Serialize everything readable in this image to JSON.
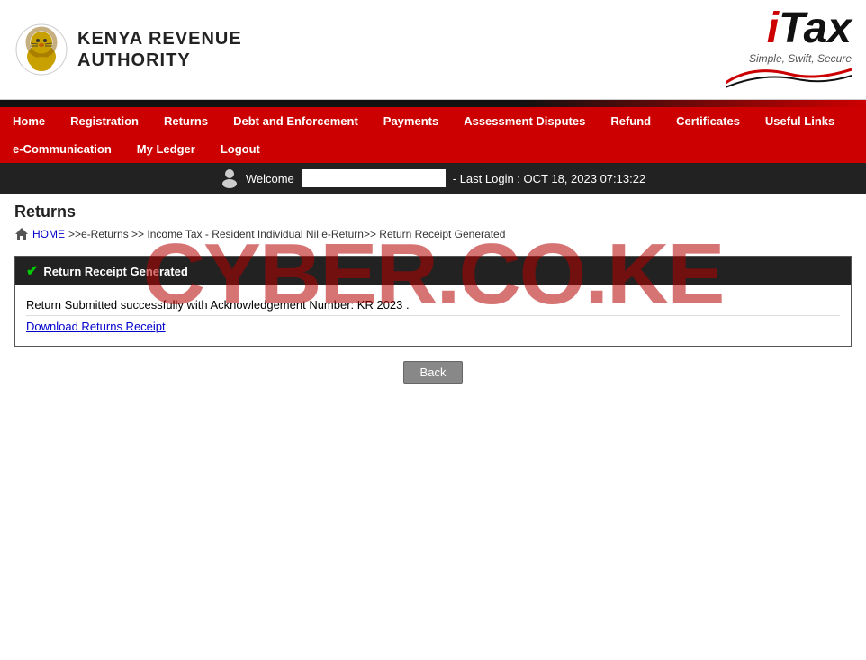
{
  "header": {
    "kra_line1": "Kenya Revenue",
    "kra_line2": "Authority",
    "itax_i": "i",
    "itax_tax": "Tax",
    "itax_tagline": "Simple, Swift, Secure"
  },
  "nav": {
    "row1": [
      {
        "label": "Home",
        "id": "home"
      },
      {
        "label": "Registration",
        "id": "registration"
      },
      {
        "label": "Returns",
        "id": "returns"
      },
      {
        "label": "Debt and Enforcement",
        "id": "debt"
      },
      {
        "label": "Payments",
        "id": "payments"
      },
      {
        "label": "Assessment Disputes",
        "id": "assessment"
      },
      {
        "label": "Refund",
        "id": "refund"
      },
      {
        "label": "Certificates",
        "id": "certificates"
      },
      {
        "label": "Useful Links",
        "id": "useful"
      }
    ],
    "row2": [
      {
        "label": "e-Communication",
        "id": "ecomm"
      },
      {
        "label": "My Ledger",
        "id": "ledger"
      },
      {
        "label": "Logout",
        "id": "logout"
      }
    ]
  },
  "welcome_bar": {
    "welcome_text": "Welcome",
    "last_login": "- Last Login : OCT 18, 2023 07:13:22"
  },
  "page": {
    "title": "Returns",
    "breadcrumb": {
      "home": "HOME",
      "path": ">>e-Returns >> Income Tax - Resident Individual Nil e-Return>> Return Receipt Generated"
    }
  },
  "result_box": {
    "header": "Return Receipt Generated",
    "status_text": "Return Submitted successfully with Acknowledgement Number: KR",
    "status_suffix": "2023",
    "status_punctuation": ".",
    "download_label": "Download Returns Receipt",
    "back_button": "Back"
  },
  "watermark": {
    "text": "CYBER.CO.KE"
  }
}
